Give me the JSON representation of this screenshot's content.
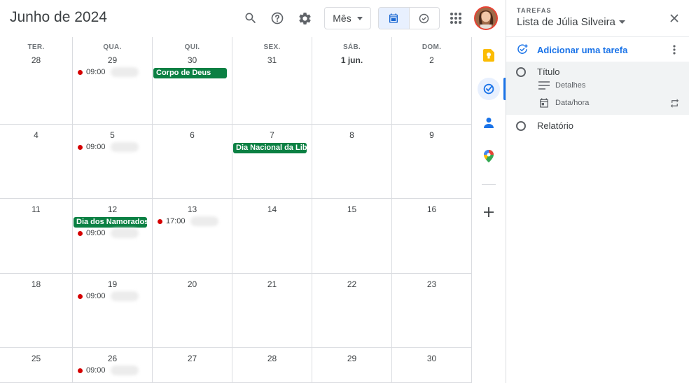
{
  "header": {
    "title": "Junho de 2024",
    "view_select": "Mês"
  },
  "colors": {
    "holiday": "#0b8043",
    "event_dot": "#d50000",
    "accent": "#1a73e8"
  },
  "calendar": {
    "weekdays": [
      "TER.",
      "QUA.",
      "QUI.",
      "SEX.",
      "SÁB.",
      "DOM."
    ],
    "weeks": [
      [
        "28",
        "29",
        "30",
        "31",
        "1 jun.",
        "2"
      ],
      [
        "4",
        "5",
        "6",
        "7",
        "8",
        "9"
      ],
      [
        "11",
        "12",
        "13",
        "14",
        "15",
        "16"
      ],
      [
        "18",
        "19",
        "20",
        "21",
        "22",
        "23"
      ],
      [
        "25",
        "26",
        "27",
        "28",
        "29",
        "30"
      ]
    ],
    "holidays": [
      {
        "week": 0,
        "day": 2,
        "label": "Corpo de Deus"
      },
      {
        "week": 1,
        "day": 3,
        "label": "Dia Nacional da Liber"
      },
      {
        "week": 2,
        "day": 1,
        "label": "Dia dos Namorados"
      }
    ],
    "timed_events": [
      {
        "week": 0,
        "day": 1,
        "time": "09:00"
      },
      {
        "week": 1,
        "day": 1,
        "time": "09:00"
      },
      {
        "week": 2,
        "day": 1,
        "time": "09:00"
      },
      {
        "week": 2,
        "day": 2,
        "time": "17:00"
      },
      {
        "week": 3,
        "day": 1,
        "time": "09:00"
      },
      {
        "week": 4,
        "day": 1,
        "time": "09:00"
      }
    ]
  },
  "tasks": {
    "section_label": "TAREFAS",
    "list_title": "Lista de Júlia Silveira",
    "add_task": "Adicionar uma tarefa",
    "new_task_title": "Título",
    "details": "Detalhes",
    "date_time": "Data/hora",
    "items": [
      "Relatório"
    ]
  }
}
